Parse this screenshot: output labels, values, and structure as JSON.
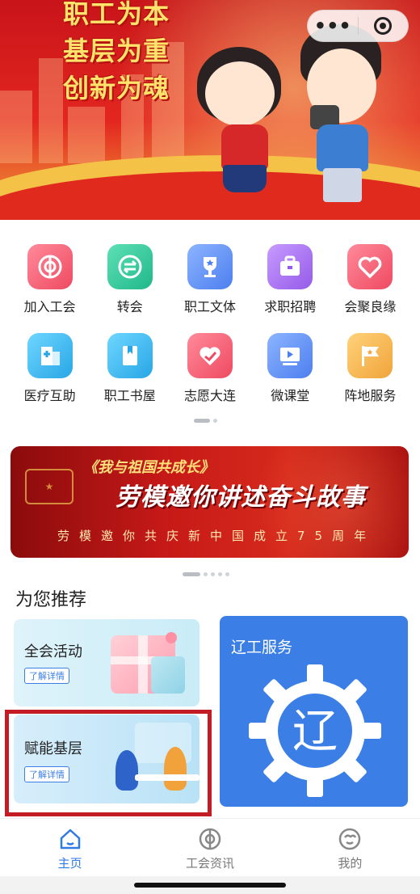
{
  "hero": {
    "slogans": [
      "职工为本",
      "基层为重",
      "创新为魂"
    ]
  },
  "capsule": {
    "more_icon": "more-dots-icon",
    "close_icon": "target-close-icon"
  },
  "services": [
    {
      "label": "加入工会",
      "icon": "union-emblem-icon",
      "color": "#f05a6e"
    },
    {
      "label": "转会",
      "icon": "transfer-icon",
      "color": "#2ec79b"
    },
    {
      "label": "职工文体",
      "icon": "trophy-icon",
      "color": "#5b8ff5"
    },
    {
      "label": "求职招聘",
      "icon": "briefcase-icon",
      "color": "#a76ef0"
    },
    {
      "label": "会聚良缘",
      "icon": "heart-icon",
      "color": "#f4566c"
    },
    {
      "label": "医疗互助",
      "icon": "hospital-icon",
      "color": "#3fb6ec"
    },
    {
      "label": "职工书屋",
      "icon": "book-icon",
      "color": "#38b9f0"
    },
    {
      "label": "志愿大连",
      "icon": "volunteer-heart-icon",
      "color": "#f05a6e"
    },
    {
      "label": "微课堂",
      "icon": "video-class-icon",
      "color": "#5b8ff5"
    },
    {
      "label": "阵地服务",
      "icon": "flag-icon",
      "color": "#f4b64c"
    }
  ],
  "promo": {
    "line1": "《我与祖国共成长》",
    "line2": "劳模邀你讲述奋斗故事",
    "line3": "劳模邀你共庆新中国成立75周年"
  },
  "recommend": {
    "title": "为您推荐",
    "activity": {
      "name": "全会活动",
      "more": "了解详情"
    },
    "base": {
      "name": "赋能基层",
      "more": "了解详情"
    },
    "service": {
      "name": "辽工服务",
      "logo_char": "辽"
    }
  },
  "tabbar": {
    "tabs": [
      {
        "label": "主页",
        "icon": "home-icon",
        "active": true
      },
      {
        "label": "工会资讯",
        "icon": "union-news-icon",
        "active": false
      },
      {
        "label": "我的",
        "icon": "profile-icon",
        "active": false
      }
    ],
    "active_color": "#2f7ae5"
  }
}
